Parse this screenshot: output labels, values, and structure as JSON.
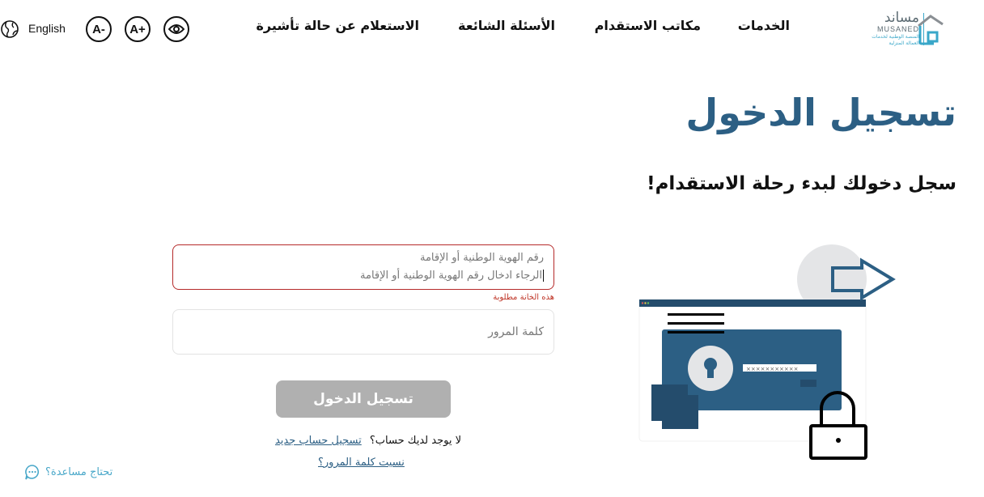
{
  "header": {
    "logo": {
      "brand_ar": "مساند",
      "brand_en": "MUSANED",
      "brand_sub": "المنصة الوطنية لخدمات العمالة المنزلية",
      "icon": "musaned-house-icon"
    },
    "nav": [
      {
        "label": "الخدمات"
      },
      {
        "label": "مكاتب الاستقدام"
      },
      {
        "label": "الأسئلة الشائعة"
      },
      {
        "label": "الاستعلام عن حالة تأشيرة"
      }
    ],
    "tools": {
      "language_label": "English",
      "language_icon": "globe-icon",
      "decrease_font": "A-",
      "increase_font": "A+",
      "visibility_icon": "eye-icon"
    }
  },
  "page": {
    "title": "تسجيل الدخول",
    "subtitle": "سجل دخولك لبدء رحلة الاستقدام!"
  },
  "form": {
    "id_field": {
      "label": "رقم الهوية الوطنية أو الإقامة",
      "placeholder": "الرجاء ادخال رقم الهوية الوطنية أو الإقامة",
      "value": "",
      "error": "هذه الخانة مطلوبة"
    },
    "password_field": {
      "placeholder": "كلمة المرور",
      "value": ""
    },
    "submit_label": "تسجيل الدخول",
    "no_account_text": "لا يوجد لديك حساب؟",
    "signup_link": "تسجيل حساب جديد",
    "forgot_link": "نسيت كلمة المرور؟"
  },
  "help": {
    "label": "تحتاج مساعدة؟",
    "icon": "chat-bubble-icon"
  },
  "illustration": {
    "password_mask": "×××××××××××"
  },
  "colors": {
    "primary": "#2c5f84",
    "error": "#b52a2a",
    "disabled_button": "#b0b0b0",
    "help": "#4aa8c9",
    "logo_accent": "#3aa7c9"
  }
}
